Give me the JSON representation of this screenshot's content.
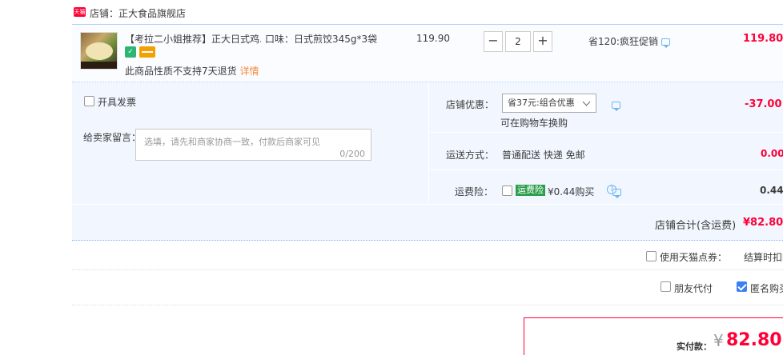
{
  "shop": {
    "badge": "天猫",
    "label": "店铺：正大食品旗舰店"
  },
  "item": {
    "title": "【考拉二小姐推荐】正大日式鸡...",
    "flavor": "口味：日式煎饺345g*3袋",
    "badge1": "✓",
    "no_return": "此商品性质不支持7天退货",
    "detail_link": "详情",
    "unit_price": "119.90",
    "quantity": "2",
    "minus": "−",
    "plus": "+",
    "promo": "省120:疯狂促销",
    "total": "119.80"
  },
  "invoice": {
    "label": "开具发票"
  },
  "message": {
    "label": "给卖家留言：",
    "placeholder": "选填，请先和商家协商一致，付款后商家可见",
    "count": "0/200"
  },
  "coupon": {
    "label": "店铺优惠：",
    "selected": "省37元:组合优惠",
    "sub": "可在购物车换购",
    "discount": "-37.00"
  },
  "shipping": {
    "label": "运送方式：",
    "value": "普通配送 快递 免邮",
    "price": "0.00"
  },
  "insurance": {
    "label": "运费险：",
    "tag": "运费险",
    "price": "¥0.44购买",
    "help": "?",
    "amount": "0.44"
  },
  "shop_total": {
    "label": "店铺合计(含运费)",
    "value": "¥82.80"
  },
  "tmall_points": {
    "label": "使用天猫点券：",
    "deduct": "结算时扣除"
  },
  "friend_pay": {
    "label": "朋友代付"
  },
  "anonymous": {
    "label": "匿名购买"
  },
  "payment": {
    "label": "实付款：",
    "currency": "¥",
    "amount": "82.80"
  },
  "colors": {
    "accent_red": "#ff0036",
    "border_blue": "#b2d1ff",
    "panel_bg": "#f2f7ff"
  }
}
